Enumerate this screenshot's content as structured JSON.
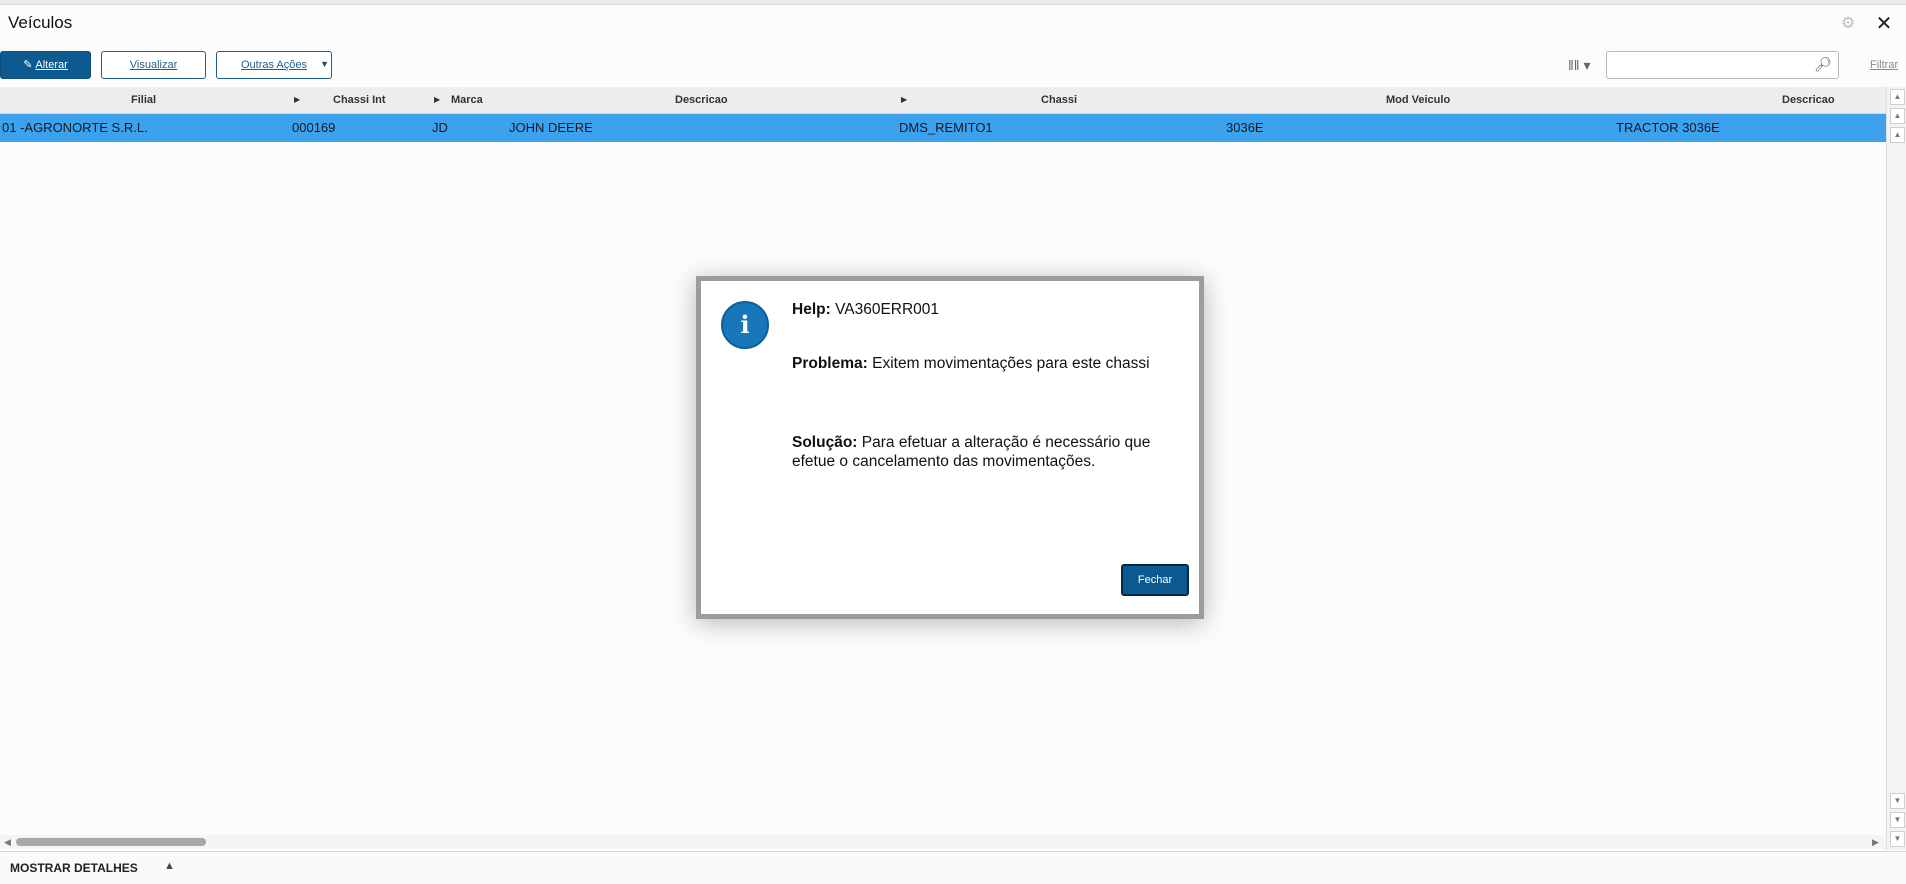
{
  "window": {
    "title": "Veículos"
  },
  "toolbar": {
    "alterar": "Alterar",
    "visualizar": "Visualizar",
    "outras_acoes": "Outras Ações",
    "filtrar": "Filtrar",
    "search_value": ""
  },
  "grid": {
    "columns": [
      "Filial",
      "Chassi Int",
      "Marca",
      "Descricao",
      "Chassi",
      "Mod Veiculo",
      "Descricao"
    ],
    "rows": [
      {
        "filial": "01 -AGRONORTE S.R.L.",
        "chassi_int": "000169",
        "marca": "JD",
        "descricao": "JOHN DEERE",
        "chassi": "DMS_REMITO1",
        "mod_veiculo": "3036E",
        "descricao2": "TRACTOR 3036E"
      }
    ],
    "selected_row": 0
  },
  "footer": {
    "details_label": "MOSTRAR DETALHES"
  },
  "dialog": {
    "help_label": "Help:",
    "help_code": "VA360ERR001",
    "problema_label": "Problema:",
    "problema_text": "Exitem movimentações para este chassi",
    "solucao_label": "Solução:",
    "solucao_text_1": "Para efetuar a alteração é necessário que",
    "solucao_text_2": "efetue o cancelamento das movimentações.",
    "fechar": "Fechar",
    "icon": "info-icon"
  },
  "colors": {
    "primary_button": "#0c5a90",
    "selected_row": "#3da2ee",
    "info_icon": "#1677ba"
  },
  "icons": [
    "gear-icon",
    "close-icon",
    "pencil-icon",
    "chevron-down-icon",
    "column-picker-icon",
    "search-icon",
    "info-icon"
  ]
}
